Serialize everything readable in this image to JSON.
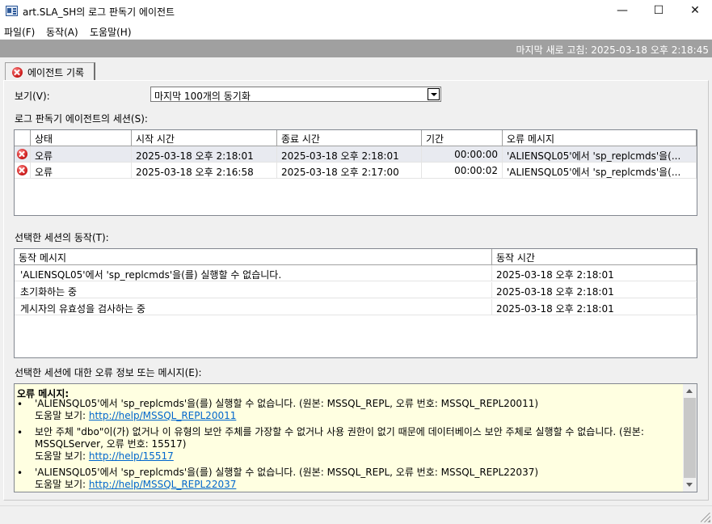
{
  "window": {
    "title": "art.SLA_SH의 로그 판독기 에이전트",
    "minimize": "—",
    "maximize": "☐",
    "close": "✕"
  },
  "menu": [
    "파일(F)",
    "동작(A)",
    "도움말(H)"
  ],
  "status": {
    "last_refresh": "마지막 새로 고침: 2025-03-18 오후 2:18:45"
  },
  "tab": {
    "label": "에이전트 기록"
  },
  "view": {
    "label": "보기(V):",
    "selected": "마지막 100개의 동기화"
  },
  "sessions": {
    "label": "로그 판독기 에이전트의 세션(S):",
    "columns": [
      "상태",
      "시작 시간",
      "종료 시간",
      "기간",
      "오류 메시지"
    ],
    "rows": [
      {
        "status": "오류",
        "start": "2025-03-18 오후 2:18:01",
        "end": "2025-03-18 오후 2:18:01",
        "duration": "00:00:00",
        "error": "'ALIENSQL05'에서 'sp_replcmds'을(..."
      },
      {
        "status": "오류",
        "start": "2025-03-18 오후 2:16:58",
        "end": "2025-03-18 오후 2:17:00",
        "duration": "00:00:02",
        "error": "'ALIENSQL05'에서 'sp_replcmds'을(..."
      }
    ]
  },
  "actions": {
    "label": "선택한 세션의 동작(T):",
    "columns": [
      "동작 메시지",
      "동작 시간"
    ],
    "rows": [
      {
        "message": "'ALIENSQL05'에서 'sp_replcmds'을(를) 실행할 수 없습니다.",
        "time": "2025-03-18 오후 2:18:01"
      },
      {
        "message": "초기화하는 중",
        "time": "2025-03-18 오후 2:18:01"
      },
      {
        "message": "게시자의 유효성을 검사하는 중",
        "time": "2025-03-18 오후 2:18:01"
      }
    ]
  },
  "errors": {
    "label": "선택한 세션에 대한 오류 정보 또는 메시지(E):",
    "header": "오류 메시지:",
    "help_prefix": "도움말 보기: ",
    "items": [
      {
        "text": "'ALIENSQL05'에서 'sp_replcmds'을(를) 실행할 수 없습니다. (원본: MSSQL_REPL, 오류 번호: MSSQL_REPL20011)",
        "link": "http://help/MSSQL_REPL20011"
      },
      {
        "text": "보안 주체 \"dbo\"이(가) 없거나 이 유형의 보안 주체를 가장할 수 없거나 사용 권한이 없기 때문에 데이터베이스 보안 주체로 실행할 수 없습니다. (원본: MSSQLServer, 오류 번호: 15517)",
        "link": "http://help/15517"
      },
      {
        "text": "'ALIENSQL05'에서 'sp_replcmds'을(를) 실행할 수 없습니다. (원본: MSSQL_REPL, 오류 번호: MSSQL_REPL22037)",
        "link": "http://help/MSSQL_REPL22037"
      }
    ]
  }
}
